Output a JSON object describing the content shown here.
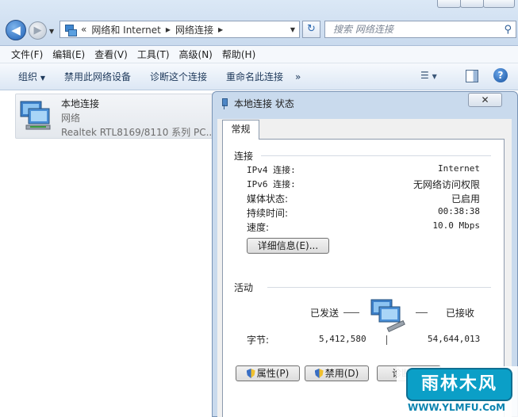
{
  "window": {
    "breadcrumb": [
      "网络和 Internet",
      "网络连接"
    ],
    "breadcrumb_prefix": "«",
    "search_placeholder": "搜索 网络连接"
  },
  "menu": [
    "文件(F)",
    "编辑(E)",
    "查看(V)",
    "工具(T)",
    "高级(N)",
    "帮助(H)"
  ],
  "commands": [
    "组织",
    "禁用此网络设备",
    "诊断这个连接",
    "重命名此连接"
  ],
  "more_chevron": "»",
  "connection": {
    "name": "本地连接",
    "type": "网络",
    "device": "Realtek RTL8169/8110 系列 PC..."
  },
  "dialog": {
    "title": "本地连接 状态",
    "tab": "常规",
    "connection_group": "连接",
    "rows": [
      {
        "label": "IPv4 连接:",
        "value": "Internet"
      },
      {
        "label": "IPv6 连接:",
        "value": "无网络访问权限"
      },
      {
        "label": "媒体状态:",
        "value": "已启用"
      },
      {
        "label": "持续时间:",
        "value": "00:38:38"
      },
      {
        "label": "速度:",
        "value": "10.0 Mbps"
      }
    ],
    "details_button": "详细信息(E)...",
    "activity_group": "活动",
    "sent_label": "已发送",
    "received_label": "已接收",
    "bytes_label": "字节:",
    "bytes_sent": "5,412,580",
    "bytes_received": "54,644,013",
    "buttons": {
      "properties": "属性(P)",
      "disable": "禁用(D)",
      "diagnose": "诊断(G)"
    }
  },
  "watermark": {
    "text": "雨林木风",
    "url": "WWW.YLMFU.CoM"
  },
  "colors": {
    "accent": "#1d5fb5",
    "dialog_frame": "#c9daed"
  }
}
